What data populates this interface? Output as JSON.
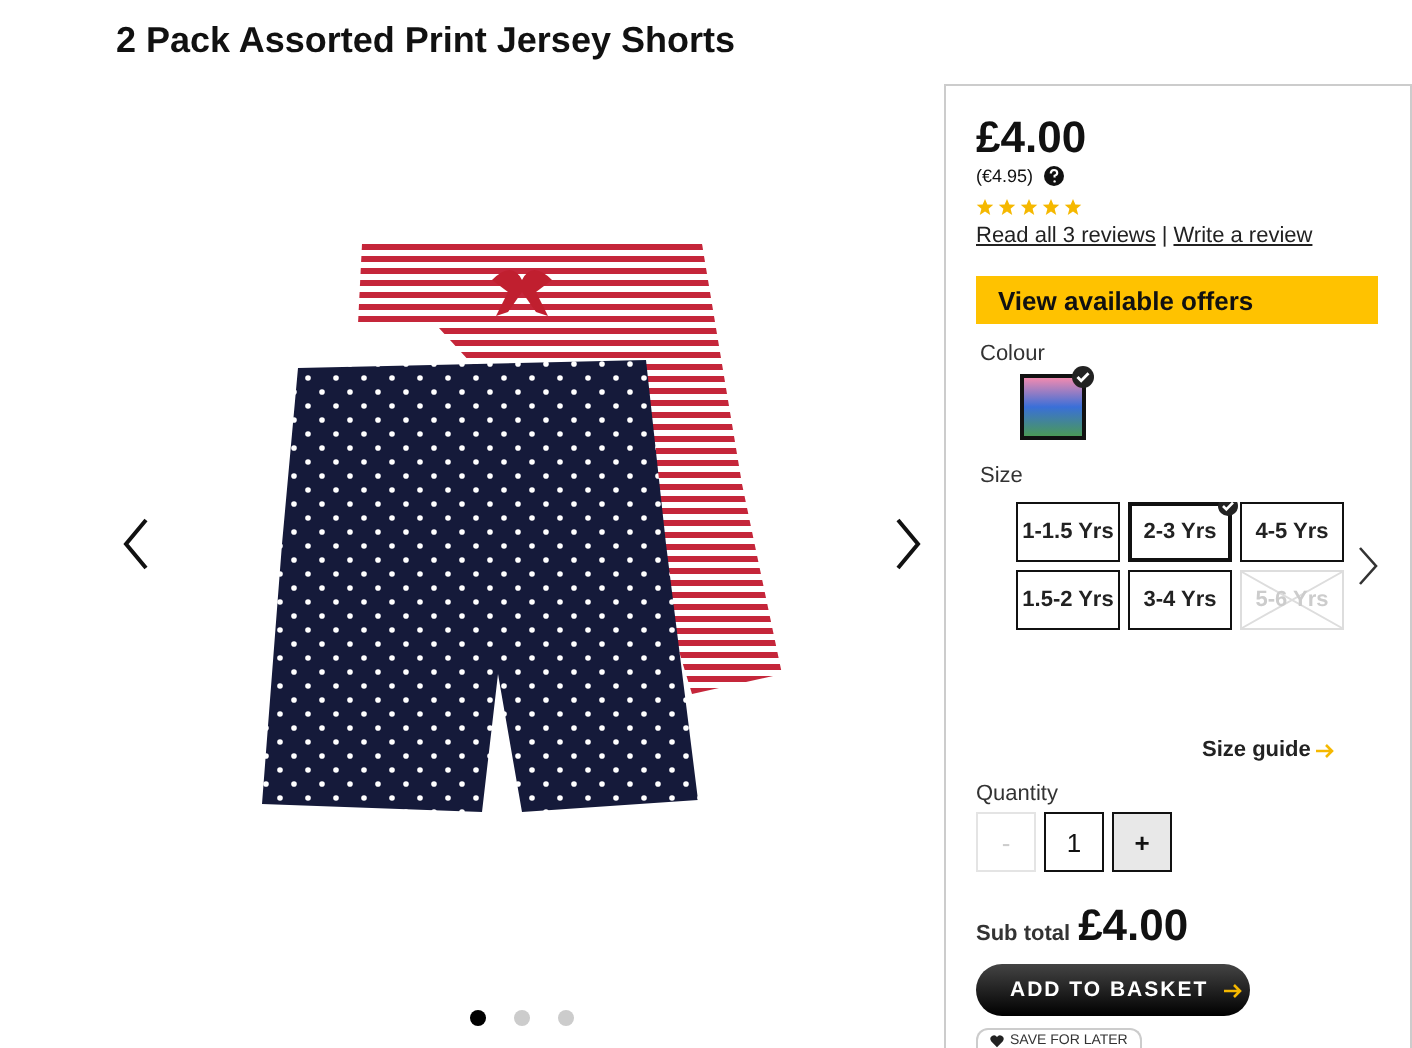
{
  "title": "2 Pack Assorted Print Jersey Shorts",
  "gallery": {
    "dots": [
      {
        "selected": true
      },
      {
        "selected": false
      },
      {
        "selected": false
      }
    ]
  },
  "panel": {
    "price": "£4.00",
    "alt_price": "(€4.95)",
    "stars": 5,
    "reviews_link": "Read all 3 reviews",
    "separator": "|",
    "write_review_link": "Write a review",
    "offers_button": "View available offers",
    "colour_label": "Colour",
    "colours": [
      {
        "selected": true
      }
    ],
    "size_label": "Size",
    "sizes": [
      {
        "label": "1-1.5 Yrs",
        "selected": false,
        "disabled": false
      },
      {
        "label": "2-3 Yrs",
        "selected": true,
        "disabled": false
      },
      {
        "label": "4-5 Yrs",
        "selected": false,
        "disabled": false
      },
      {
        "label": "1.5-2 Yrs",
        "selected": false,
        "disabled": false
      },
      {
        "label": "3-4 Yrs",
        "selected": false,
        "disabled": false
      },
      {
        "label": "5-6 Yrs",
        "selected": false,
        "disabled": true
      }
    ],
    "size_guide": "Size guide",
    "quantity_label": "Quantity",
    "quantity": "1",
    "minus": {
      "label": "-",
      "disabled": true
    },
    "plus": {
      "label": "+",
      "disabled": false
    },
    "subtotal_label": "Sub total",
    "subtotal": "£4.00",
    "add_to_basket": "ADD TO BASKET",
    "save_for_later": "SAVE FOR LATER"
  }
}
